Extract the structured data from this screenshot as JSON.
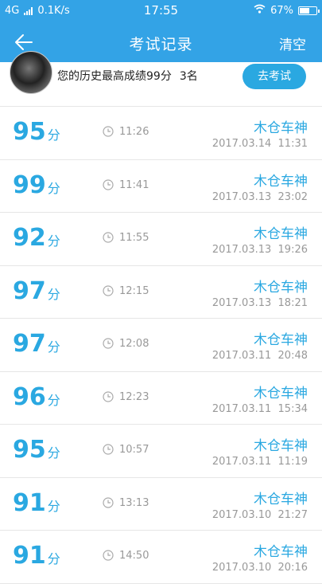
{
  "status_bar": {
    "network": "4G",
    "speed": "0.1K/s",
    "time": "17:55",
    "battery": "67%",
    "battery_level": 0.67
  },
  "header": {
    "back_icon": "arrow-left-icon",
    "title": "考试记录",
    "clear_label": "清空"
  },
  "summary": {
    "text": "您的历史最高成绩99分",
    "rank": "3名",
    "button_label": "去考试"
  },
  "colors": {
    "header_bg": "#33a3e6",
    "accent": "#2aa8e1"
  },
  "score_unit": "分",
  "records": [
    {
      "score": "95",
      "duration": "11:26",
      "user": "木仓车神",
      "datetime": "2017.03.14  11:31"
    },
    {
      "score": "99",
      "duration": "11:41",
      "user": "木仓车神",
      "datetime": "2017.03.13  23:02"
    },
    {
      "score": "92",
      "duration": "11:55",
      "user": "木仓车神",
      "datetime": "2017.03.13  19:26"
    },
    {
      "score": "97",
      "duration": "12:15",
      "user": "木仓车神",
      "datetime": "2017.03.13  18:21"
    },
    {
      "score": "97",
      "duration": "12:08",
      "user": "木仓车神",
      "datetime": "2017.03.11  20:48"
    },
    {
      "score": "96",
      "duration": "12:23",
      "user": "木仓车神",
      "datetime": "2017.03.11  15:34"
    },
    {
      "score": "95",
      "duration": "10:57",
      "user": "木仓车神",
      "datetime": "2017.03.11  11:19"
    },
    {
      "score": "91",
      "duration": "13:13",
      "user": "木仓车神",
      "datetime": "2017.03.10  21:27"
    },
    {
      "score": "91",
      "duration": "14:50",
      "user": "木仓车神",
      "datetime": "2017.03.10  20:16"
    }
  ]
}
